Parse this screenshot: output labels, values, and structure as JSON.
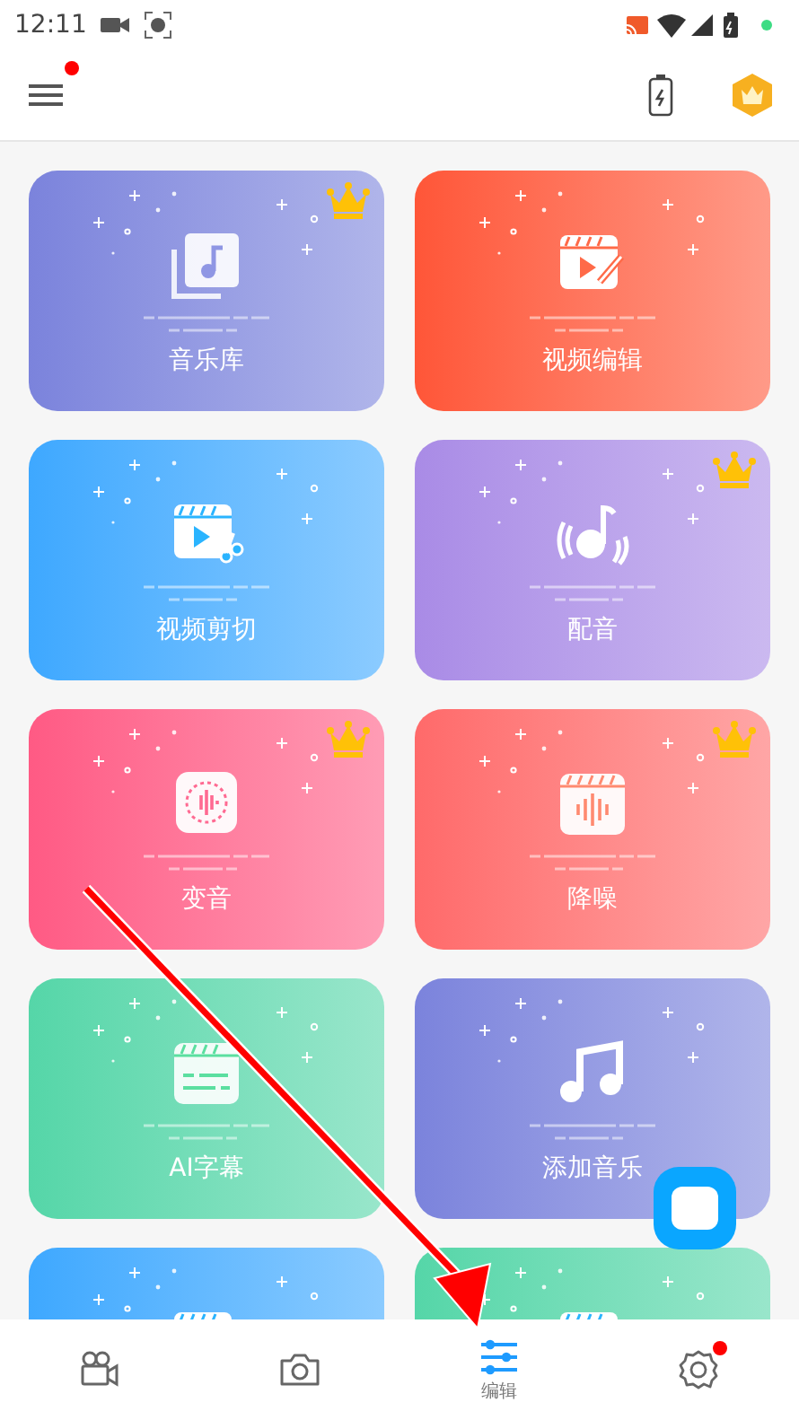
{
  "status_bar": {
    "time": "12:11"
  },
  "app_bar": {
    "menu_badge": true
  },
  "cards": [
    {
      "label": "音乐库",
      "kind": "library",
      "color": "#7b83dc",
      "premium": true
    },
    {
      "label": "视频编辑",
      "kind": "video-edit",
      "color": "#ff5638",
      "premium": false
    },
    {
      "label": "视频剪切",
      "kind": "video-cut",
      "color": "#3ea8ff",
      "premium": false
    },
    {
      "label": "配音",
      "kind": "dubbing",
      "color": "#a98be6",
      "premium": true
    },
    {
      "label": "变音",
      "kind": "voice-change",
      "color": "#ff5a84",
      "premium": true
    },
    {
      "label": "降噪",
      "kind": "denoise",
      "color": "#ff6a6a",
      "premium": true
    },
    {
      "label": "AI字幕",
      "kind": "subtitle",
      "color": "#55d6a8",
      "premium": false
    },
    {
      "label": "添加音乐",
      "kind": "music",
      "color": "#7b83dc",
      "premium": false
    },
    {
      "kind": "video-cut",
      "color": "#3ea8ff",
      "premium": false
    },
    {
      "kind": "video-cut",
      "color": "#55d6a8",
      "premium": false
    }
  ],
  "bottom_nav": [
    {
      "kind": "video",
      "selected": false,
      "badge": false
    },
    {
      "kind": "camera",
      "selected": false,
      "badge": false
    },
    {
      "kind": "edit",
      "selected": true,
      "label": "编辑",
      "badge": false
    },
    {
      "kind": "settings",
      "selected": false,
      "badge": true
    }
  ]
}
